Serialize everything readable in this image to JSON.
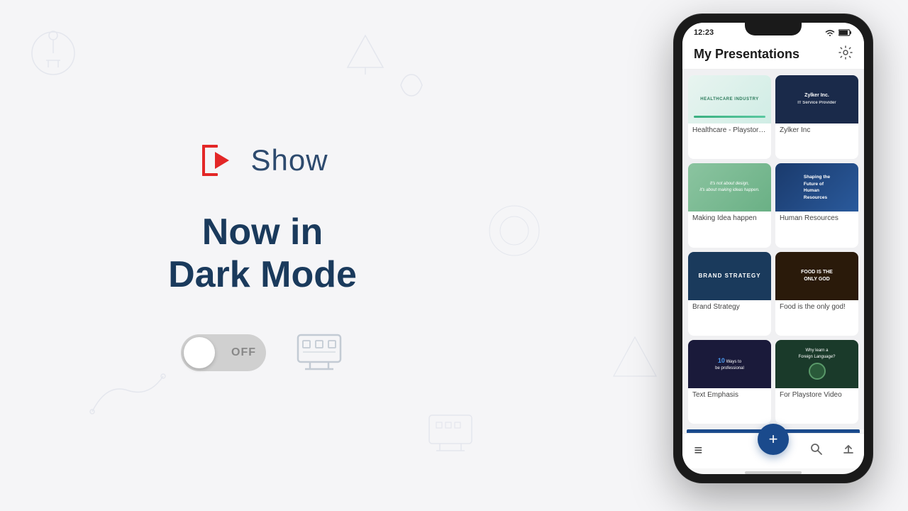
{
  "app": {
    "name": "Show",
    "tagline_line1": "Now in",
    "tagline_line2": "Dark Mode",
    "toggle_state": "OFF"
  },
  "phone": {
    "status_bar": {
      "time": "12:23",
      "battery_icon": "🔋",
      "wifi_icon": "▾"
    },
    "header": {
      "title": "My Presentations",
      "settings_label": "⚙"
    },
    "presentations": [
      {
        "id": 1,
        "name": "Healthcare - Playstore ...",
        "thumb_style": "healthcare"
      },
      {
        "id": 2,
        "name": "Zylker Inc",
        "thumb_style": "zylker"
      },
      {
        "id": 3,
        "name": "Making Idea happen",
        "thumb_style": "making-idea"
      },
      {
        "id": 4,
        "name": "Human Resources",
        "thumb_style": "human-res"
      },
      {
        "id": 5,
        "name": "Brand Strategy",
        "thumb_style": "brand"
      },
      {
        "id": 6,
        "name": "Food is the only god!",
        "thumb_style": "food"
      },
      {
        "id": 7,
        "name": "Text Emphasis",
        "thumb_style": "text-emphasis"
      },
      {
        "id": 8,
        "name": "For Playstore Video",
        "thumb_style": "playstore"
      }
    ],
    "nav": {
      "menu_icon": "≡",
      "fab_icon": "+",
      "search_icon": "🔍",
      "share_icon": "⬆"
    }
  },
  "colors": {
    "accent_red": "#e32727",
    "brand_blue": "#1a3a5c",
    "toggle_off": "#c8c8c8",
    "phone_bg": "#1a1a1a"
  },
  "thumb_labels": {
    "healthcare": "HEALTHCARE INDUSTRY",
    "zylker": "Zylker Inc. IT Service Provider",
    "making_idea": "It's not about design,\nit's about making ideas happen.",
    "human_res": "Shaping the Future of Human Resources",
    "brand": "BRAND STRATEGY",
    "food": "FOOD IS THE ONLY GOD",
    "text_emphasis": "10 Ways to be professional",
    "playstore": "Why learn a Foreign Language?"
  }
}
